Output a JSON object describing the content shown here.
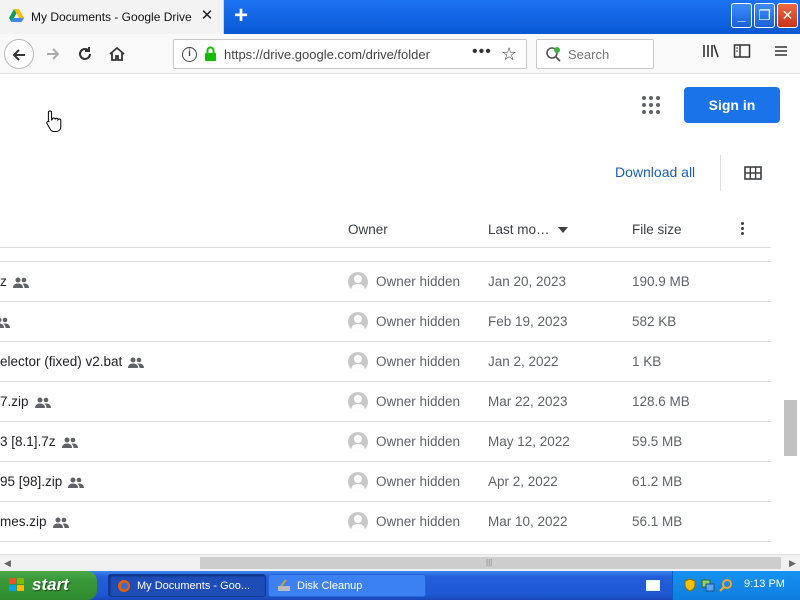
{
  "browser": {
    "tab_title": "My Documents - Google Drive",
    "tab_close": "✕",
    "new_tab": "+",
    "url": "https://drive.google.com/drive/folder",
    "search_placeholder": "Search",
    "window_buttons": {
      "minimize": "_",
      "restore": "❐",
      "close": "✕"
    }
  },
  "header": {
    "signin_label": "Sign in",
    "download_all_label": "Download all"
  },
  "table": {
    "columns": {
      "owner": "Owner",
      "last_modified": "Last mo…",
      "file_size": "File size"
    },
    "rows": [
      {
        "name": "z",
        "owner": "Owner hidden",
        "date": "Jan 20, 2023",
        "size": "190.9 MB"
      },
      {
        "name": "",
        "owner": "Owner hidden",
        "date": "Feb 19, 2023",
        "size": "582 KB"
      },
      {
        "name": "elector (fixed) v2.bat",
        "owner": "Owner hidden",
        "date": "Jan 2, 2022",
        "size": "1 KB"
      },
      {
        "name": "7.zip",
        "owner": "Owner hidden",
        "date": "Mar 22, 2023",
        "size": "128.6 MB"
      },
      {
        "name": "3 [8.1].7z",
        "owner": "Owner hidden",
        "date": "May 12, 2022",
        "size": "59.5 MB"
      },
      {
        "name": "95 [98].zip",
        "owner": "Owner hidden",
        "date": "Apr 2, 2022",
        "size": "61.2 MB"
      },
      {
        "name": "mes.zip",
        "owner": "Owner hidden",
        "date": "Mar 10, 2022",
        "size": "56.1 MB"
      }
    ]
  },
  "taskbar": {
    "start_label": "start",
    "tasks": [
      {
        "label": "My Documents - Goo..."
      },
      {
        "label": "Disk Cleanup"
      }
    ],
    "clock": "9:13 PM"
  },
  "colors": {
    "accent": "#1a73e8",
    "link": "#1a5fb4",
    "xp_blue": "#245edb",
    "xp_green": "#3a9a3a"
  }
}
